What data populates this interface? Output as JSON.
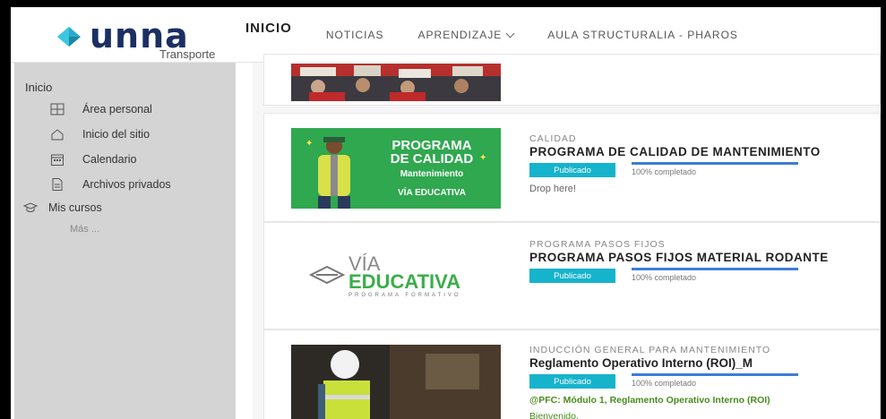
{
  "header": {
    "brand": "unna",
    "brand_sub": "Transporte",
    "nav": {
      "inicio": "INICIO",
      "noticias": "NOTICIAS",
      "aprendizaje": "APRENDIZAJE",
      "aula": "AULA STRUCTURALIA - PHAROS"
    }
  },
  "sidebar": {
    "home": "Inicio",
    "items": [
      "Área personal",
      "Inicio del sitio",
      "Calendario",
      "Archivos privados"
    ],
    "courses": "Mis cursos",
    "more": "Más ..."
  },
  "courses": [
    {
      "category": "CALIDAD",
      "title": "PROGRAMA DE CALIDAD DE MANTENIMIENTO",
      "status": "Publicado",
      "progress_text": "100% completado",
      "progress": 1.0,
      "note": "Drop here!",
      "thumb": {
        "line1": "PROGRAMA",
        "line2": "DE CALIDAD",
        "line3": "Mantenimiento",
        "brand1": "VÍA",
        "brand2": "EDUCATIVA"
      }
    },
    {
      "category": "PROGRAMA PASOS FIJOS",
      "title": "PROGRAMA PASOS FIJOS MATERIAL RODANTE",
      "status": "Publicado",
      "progress_text": "100% completado",
      "progress": 1.0,
      "thumb": {
        "brand1": "VÍA",
        "brand2": "EDUCATIVA",
        "brand3": "PROGRAMA FORMATIVO"
      }
    },
    {
      "category": "INDUCCIÓN GENERAL PARA MANTENIMIENTO",
      "title": "Reglamento Operativo Interno (ROI)_M",
      "status": "Publicado",
      "progress_text": "100% completado",
      "progress": 1.0,
      "summary_title": "@PFC: Módulo 1, Reglamento Operativo Interno (ROI)",
      "summary_text": "Bienvenido,"
    }
  ],
  "colors": {
    "brand": "#1c2f63",
    "badge": "#16b3cc",
    "progress": "#3d7cd8",
    "green": "#4a8b1d",
    "thumb_green": "#2fa84f"
  }
}
